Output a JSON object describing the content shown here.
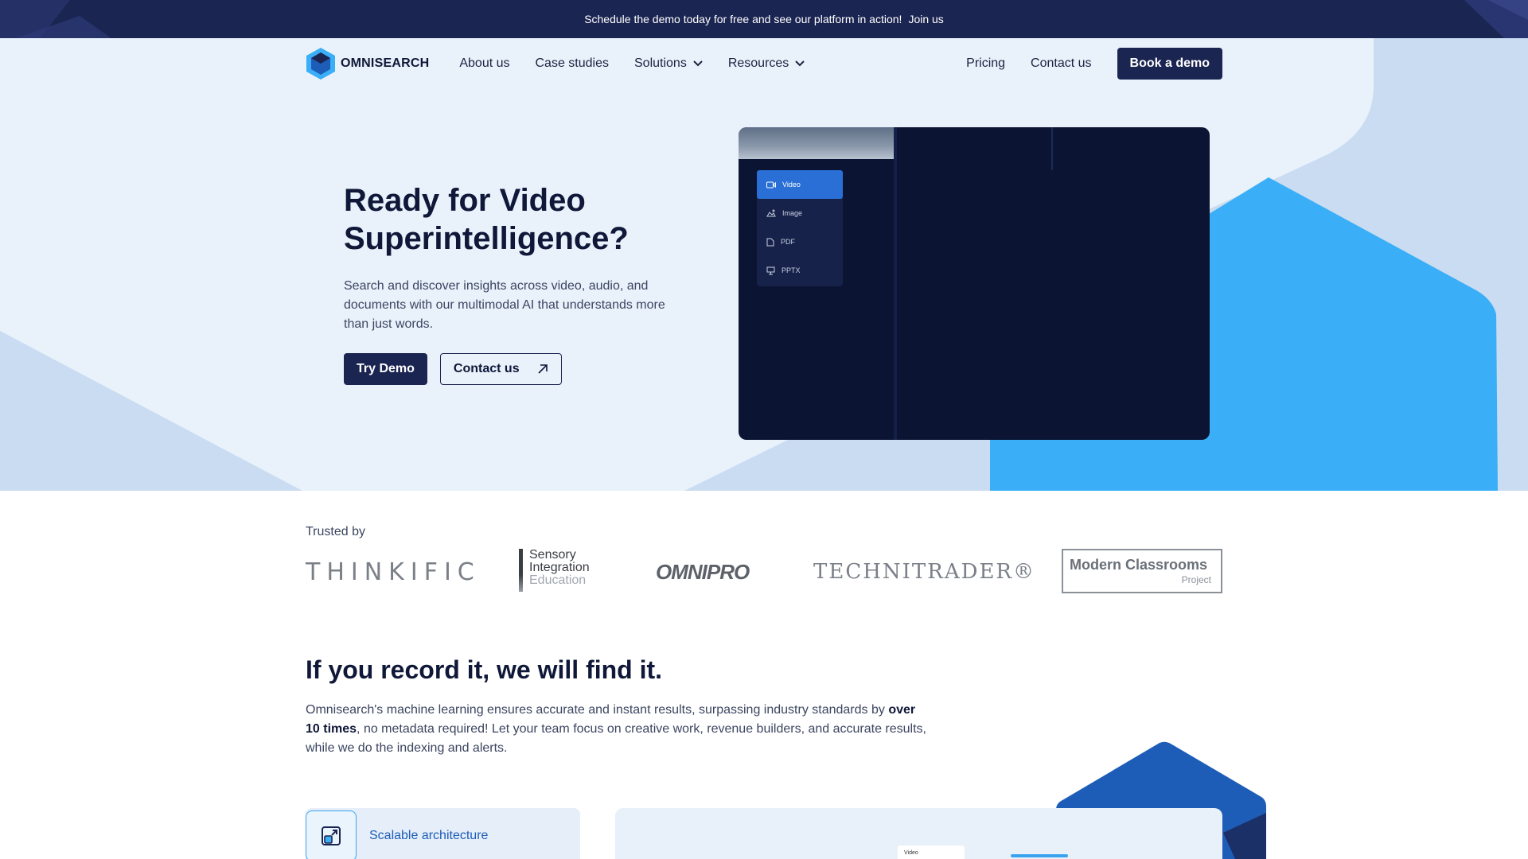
{
  "announcement": {
    "text": "Schedule the demo today for free and see our platform in action!",
    "link": "Join us"
  },
  "nav": {
    "logo_text": "OMNISEARCH",
    "items": [
      {
        "label": "About us"
      },
      {
        "label": "Case studies"
      },
      {
        "label": "Solutions"
      },
      {
        "label": "Resources"
      }
    ],
    "right_items": [
      {
        "label": "Pricing"
      },
      {
        "label": "Contact us"
      }
    ],
    "cta": "Book a demo"
  },
  "hero": {
    "title": "Ready for Video Superintelligence?",
    "subtitle": "Search and discover insights across video, audio, and documents with our multimodal AI that understands more than just words.",
    "primary_button": "Try Demo",
    "secondary_button": "Contact us"
  },
  "mockup": {
    "menu": [
      {
        "label": "Video",
        "icon": "video-icon",
        "active": true
      },
      {
        "label": "Image",
        "icon": "image-icon",
        "active": false
      },
      {
        "label": "PDF",
        "icon": "file-icon",
        "active": false
      },
      {
        "label": "PPTX",
        "icon": "presentation-icon",
        "active": false
      }
    ]
  },
  "trusted": {
    "label": "Trusted by",
    "logos": {
      "thinkific": "THINKIFIC",
      "sensory_1": "Sensory",
      "sensory_2": "Integration",
      "sensory_3": "Education",
      "omnipro": "OMNIPRO",
      "technitrader": "TECHNITRADER®",
      "mcp_1": "Modern Classrooms",
      "mcp_2": "Project"
    }
  },
  "section": {
    "title": "If you record it, we will find it.",
    "body_pre": "Omnisearch's machine learning ensures accurate and instant results, surpassing industry standards by ",
    "body_bold": "over 10 times",
    "body_post": ", no metadata required! Let your team focus on creative work, revenue builders, and accurate results, while we do the indexing and alerts."
  },
  "feature": {
    "label": "Scalable architecture",
    "icon": "expand-icon"
  },
  "preview": {
    "chip_label": "Video"
  },
  "colors": {
    "navy": "#1b2552",
    "hero_bg": "#e9f2fb",
    "accent_blue": "#3aaef7",
    "dark_panel": "#0c1433",
    "active_blue": "#2a6fd6"
  }
}
